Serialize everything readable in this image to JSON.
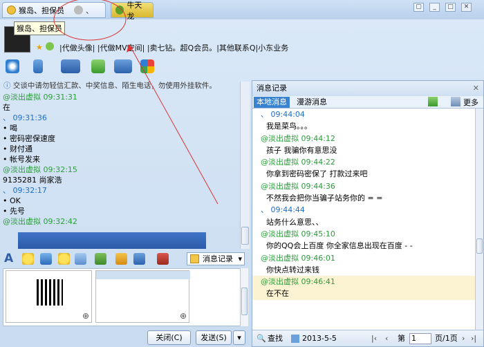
{
  "tabs": {
    "active_label": "猴岛、担保员",
    "second_label": "牛天龙"
  },
  "tooltip": "猴岛、担保员",
  "signature": "|代做头像| |代做MV空间| |卖七钻。超Q会员。|其他联系Q|小东业务",
  "notice": "交谈中请勿轻信汇款、中奖信息、陌生电话，勿使用外挂软件。",
  "chat": [
    {
      "t": "@淡出虚拟  09:31:31",
      "c": "green"
    },
    {
      "t": "   在",
      "c": ""
    },
    {
      "t": "、    09:31:36",
      "c": "blue"
    },
    {
      "t": "  • 喝",
      "c": ""
    },
    {
      "t": "  • 密码密保速度",
      "c": ""
    },
    {
      "t": "  • 财付通",
      "c": ""
    },
    {
      "t": "  • 帐号发来",
      "c": ""
    },
    {
      "t": "@淡出虚拟  09:32:15",
      "c": "green"
    },
    {
      "t": "   9135281 尚家浩",
      "c": ""
    },
    {
      "t": "、    09:32:17",
      "c": "blue"
    },
    {
      "t": "  • OK",
      "c": ""
    },
    {
      "t": "  • 先号",
      "c": ""
    },
    {
      "t": "@淡出虚拟  09:32:42",
      "c": "green"
    }
  ],
  "message_record_button": "消息记录",
  "close_button": "关闭(C)",
  "send_button": "发送(S)",
  "right": {
    "title": "消息记录",
    "tab_local": "本地消息",
    "tab_roam": "漫游消息",
    "more": "更多",
    "messages": [
      {
        "t": "、  09:44:04",
        "c": "blue",
        "k": "h"
      },
      {
        "t": "我是菜鸟。。。",
        "c": "",
        "k": "t"
      },
      {
        "t": "@淡出虚拟 09:44:12",
        "c": "green",
        "k": "h"
      },
      {
        "t": "孩子 我骗你有意思没",
        "c": "",
        "k": "t"
      },
      {
        "t": "@淡出虚拟 09:44:22",
        "c": "green",
        "k": "h"
      },
      {
        "t": "你拿到密码密保了 打款过来吧",
        "c": "",
        "k": "t"
      },
      {
        "t": "@淡出虚拟 09:44:36",
        "c": "green",
        "k": "h"
      },
      {
        "t": "不然我会把你当骗子站务你的 = =",
        "c": "",
        "k": "t"
      },
      {
        "t": "、  09:44:44",
        "c": "blue",
        "k": "h"
      },
      {
        "t": "站务什么意思、、",
        "c": "",
        "k": "t"
      },
      {
        "t": "@淡出虚拟 09:45:10",
        "c": "green",
        "k": "h"
      },
      {
        "t": "你的QQ会上百度 你全家信息出现在百度 - -",
        "c": "",
        "k": "t"
      },
      {
        "t": "@淡出虚拟 09:46:01",
        "c": "green",
        "k": "h"
      },
      {
        "t": "你快点转过来钱",
        "c": "",
        "k": "t"
      },
      {
        "t": "@淡出虚拟 09:46:41",
        "c": "green",
        "k": "h",
        "hl": true
      },
      {
        "t": "在不在",
        "c": "",
        "k": "t",
        "hl": true
      }
    ],
    "search": "查找",
    "date": "2013-5-5",
    "page_label": "第",
    "page_value": "1",
    "page_total": "页/1页"
  }
}
